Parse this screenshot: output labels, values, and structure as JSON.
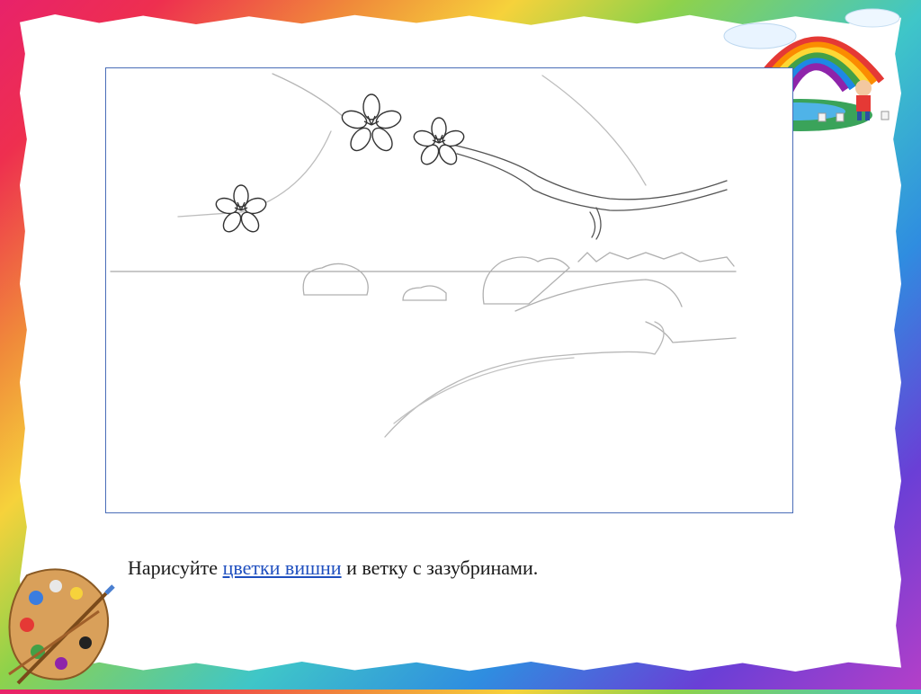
{
  "instruction": {
    "before": "Нарисуйте ",
    "link": "цветки вишни",
    "after": " и ветку с зазубринами."
  },
  "colors": {
    "link": "#1f4fbf",
    "frame_border": "#4a6db8"
  },
  "icons": [
    "rainbow-illustration",
    "paint-palette-icon"
  ]
}
